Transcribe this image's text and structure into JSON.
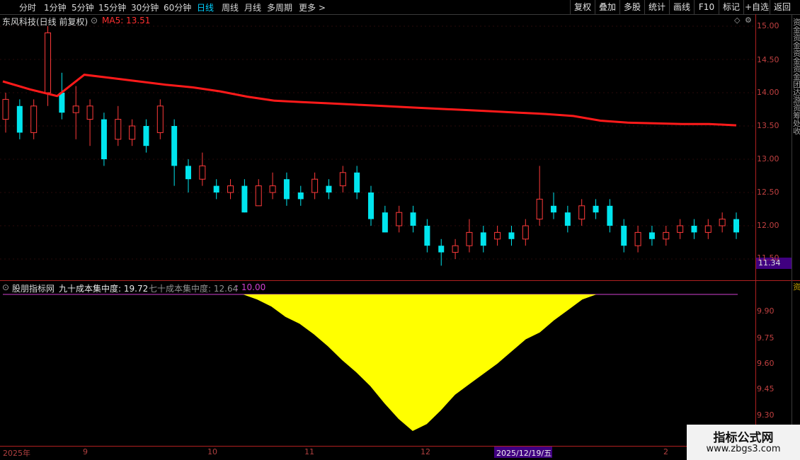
{
  "toolbar": {
    "periods": [
      "分时",
      "1分钟",
      "5分钟",
      "15分钟",
      "30分钟",
      "60分钟",
      "日线",
      "周线",
      "月线",
      "多周期",
      "更多 >"
    ],
    "active_period": "日线",
    "right_buttons": [
      "复权",
      "叠加",
      "多股",
      "统计",
      "画线",
      "F10",
      "标记",
      "+自选",
      "返回"
    ]
  },
  "main_panel": {
    "stock_title": "东风科技(日线 前复权)",
    "ma_label": "MA5: 13.51",
    "y_ticks": [
      "15.00",
      "14.50",
      "14.00",
      "13.50",
      "13.00",
      "12.50",
      "12.00",
      "11.50"
    ],
    "current_price": "11.34",
    "side_labels": [
      "资",
      "金",
      "资",
      "金",
      "资",
      "金",
      "资",
      "金",
      "团",
      "达",
      "游",
      "资",
      "筹",
      "处",
      "收"
    ]
  },
  "indicator_panel": {
    "name": "股朋指标网",
    "label1": "九十成本集中度: 19.72",
    "label2": "七十成本集中度: 12.64",
    "label3": ": 10.00",
    "y_ticks": [
      "9.90",
      "9.75",
      "9.60",
      "9.45",
      "9.30"
    ],
    "side_label": "资"
  },
  "xaxis": {
    "labels": [
      "2025年",
      "9",
      "10",
      "11",
      "12",
      "2"
    ],
    "highlight": "2025/12/19/五"
  },
  "watermark": {
    "title": "指标公式网",
    "url": "www.zbgs3.com"
  },
  "colors": {
    "up": "#ff3a3a",
    "down": "#00e5ee",
    "ma": "#ff1a1a",
    "area": "#ffff00",
    "line": "#d040d0"
  },
  "chart_data": [
    {
      "type": "candlestick",
      "title": "东风科技(日线 前复权)",
      "ylim": [
        11.34,
        15.1
      ],
      "series": [
        {
          "name": "MA5",
          "values": [
            14.17,
            14.05,
            13.95,
            14.27,
            14.22,
            14.17,
            14.12,
            14.08,
            14.02,
            13.94,
            13.88,
            13.86,
            13.84,
            13.82,
            13.8,
            13.78,
            13.76,
            13.74,
            13.72,
            13.7,
            13.68,
            13.65,
            13.58,
            13.55,
            13.54,
            13.53,
            13.53,
            13.51
          ]
        }
      ],
      "candles": [
        {
          "o": 13.6,
          "c": 13.9,
          "h": 14.0,
          "l": 13.4
        },
        {
          "o": 13.8,
          "c": 13.4,
          "h": 13.9,
          "l": 13.3
        },
        {
          "o": 13.4,
          "c": 13.8,
          "h": 13.9,
          "l": 13.3
        },
        {
          "o": 14.0,
          "c": 14.9,
          "h": 15.0,
          "l": 13.8
        },
        {
          "o": 14.0,
          "c": 13.7,
          "h": 14.3,
          "l": 13.6
        },
        {
          "o": 13.7,
          "c": 13.8,
          "h": 14.1,
          "l": 13.3
        },
        {
          "o": 13.6,
          "c": 13.8,
          "h": 13.9,
          "l": 13.2
        },
        {
          "o": 13.6,
          "c": 13.0,
          "h": 13.7,
          "l": 12.9
        },
        {
          "o": 13.3,
          "c": 13.6,
          "h": 13.8,
          "l": 13.2
        },
        {
          "o": 13.3,
          "c": 13.5,
          "h": 13.6,
          "l": 13.2
        },
        {
          "o": 13.5,
          "c": 13.2,
          "h": 13.6,
          "l": 13.1
        },
        {
          "o": 13.4,
          "c": 13.8,
          "h": 13.9,
          "l": 13.3
        },
        {
          "o": 13.5,
          "c": 12.9,
          "h": 13.6,
          "l": 12.6
        },
        {
          "o": 12.9,
          "c": 12.7,
          "h": 13.0,
          "l": 12.5
        },
        {
          "o": 12.7,
          "c": 12.9,
          "h": 13.1,
          "l": 12.6
        },
        {
          "o": 12.6,
          "c": 12.5,
          "h": 12.7,
          "l": 12.4
        },
        {
          "o": 12.5,
          "c": 12.6,
          "h": 12.7,
          "l": 12.4
        },
        {
          "o": 12.6,
          "c": 12.2,
          "h": 12.7,
          "l": 12.2
        },
        {
          "o": 12.3,
          "c": 12.6,
          "h": 12.7,
          "l": 12.3
        },
        {
          "o": 12.5,
          "c": 12.6,
          "h": 12.8,
          "l": 12.4
        },
        {
          "o": 12.7,
          "c": 12.4,
          "h": 12.8,
          "l": 12.3
        },
        {
          "o": 12.5,
          "c": 12.4,
          "h": 12.6,
          "l": 12.3
        },
        {
          "o": 12.5,
          "c": 12.7,
          "h": 12.8,
          "l": 12.4
        },
        {
          "o": 12.6,
          "c": 12.5,
          "h": 12.7,
          "l": 12.4
        },
        {
          "o": 12.6,
          "c": 12.8,
          "h": 12.9,
          "l": 12.5
        },
        {
          "o": 12.8,
          "c": 12.5,
          "h": 12.9,
          "l": 12.4
        },
        {
          "o": 12.5,
          "c": 12.1,
          "h": 12.6,
          "l": 12.0
        },
        {
          "o": 12.2,
          "c": 11.9,
          "h": 12.3,
          "l": 11.9
        },
        {
          "o": 12.0,
          "c": 12.2,
          "h": 12.3,
          "l": 11.9
        },
        {
          "o": 12.2,
          "c": 12.0,
          "h": 12.3,
          "l": 11.9
        },
        {
          "o": 12.0,
          "c": 11.7,
          "h": 12.1,
          "l": 11.6
        },
        {
          "o": 11.7,
          "c": 11.6,
          "h": 11.8,
          "l": 11.4
        },
        {
          "o": 11.6,
          "c": 11.7,
          "h": 11.8,
          "l": 11.5
        },
        {
          "o": 11.7,
          "c": 11.9,
          "h": 12.1,
          "l": 11.6
        },
        {
          "o": 11.9,
          "c": 11.7,
          "h": 12.0,
          "l": 11.6
        },
        {
          "o": 11.8,
          "c": 11.9,
          "h": 12.0,
          "l": 11.7
        },
        {
          "o": 11.9,
          "c": 11.8,
          "h": 12.0,
          "l": 11.7
        },
        {
          "o": 11.8,
          "c": 12.0,
          "h": 12.1,
          "l": 11.7
        },
        {
          "o": 12.1,
          "c": 12.4,
          "h": 12.9,
          "l": 12.0
        },
        {
          "o": 12.3,
          "c": 12.2,
          "h": 12.5,
          "l": 12.1
        },
        {
          "o": 12.2,
          "c": 12.0,
          "h": 12.3,
          "l": 11.9
        },
        {
          "o": 12.1,
          "c": 12.3,
          "h": 12.4,
          "l": 12.0
        },
        {
          "o": 12.3,
          "c": 12.2,
          "h": 12.4,
          "l": 12.1
        },
        {
          "o": 12.3,
          "c": 12.0,
          "h": 12.4,
          "l": 11.9
        },
        {
          "o": 12.0,
          "c": 11.7,
          "h": 12.1,
          "l": 11.6
        },
        {
          "o": 11.7,
          "c": 11.9,
          "h": 12.0,
          "l": 11.6
        },
        {
          "o": 11.9,
          "c": 11.8,
          "h": 12.0,
          "l": 11.7
        },
        {
          "o": 11.8,
          "c": 11.9,
          "h": 12.0,
          "l": 11.7
        },
        {
          "o": 11.9,
          "c": 12.0,
          "h": 12.1,
          "l": 11.8
        },
        {
          "o": 12.0,
          "c": 11.9,
          "h": 12.1,
          "l": 11.8
        },
        {
          "o": 11.9,
          "c": 12.0,
          "h": 12.1,
          "l": 11.8
        },
        {
          "o": 12.0,
          "c": 12.1,
          "h": 12.2,
          "l": 11.9
        },
        {
          "o": 12.1,
          "c": 11.9,
          "h": 12.2,
          "l": 11.8
        }
      ]
    },
    {
      "type": "area",
      "title": "九十成本集中度",
      "ylim": [
        9.2,
        10.05
      ],
      "series": [
        {
          "name": "九十成本集中度",
          "values": [
            10.0,
            10.0,
            10.0,
            10.0,
            10.0,
            10.0,
            10.0,
            10.0,
            10.0,
            10.0,
            10.0,
            10.0,
            10.0,
            10.0,
            10.0,
            10.0,
            10.0,
            10.0,
            9.97,
            9.93,
            9.87,
            9.83,
            9.77,
            9.7,
            9.62,
            9.55,
            9.47,
            9.37,
            9.28,
            9.21,
            9.25,
            9.33,
            9.42,
            9.48,
            9.54,
            9.6,
            9.67,
            9.74,
            9.78,
            9.85,
            9.91,
            9.97,
            10.0,
            10.0,
            10.0,
            10.0,
            10.0,
            10.0,
            10.0,
            10.0,
            10.0,
            10.0,
            10.0
          ]
        }
      ]
    }
  ]
}
